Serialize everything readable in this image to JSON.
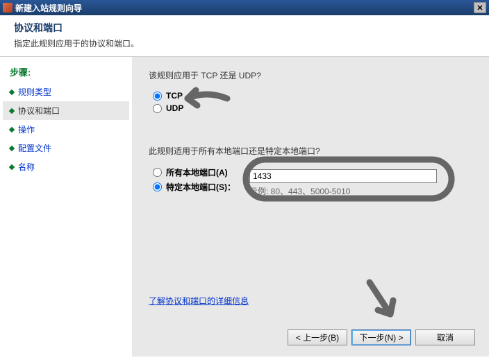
{
  "window": {
    "title": "新建入站规则向导"
  },
  "header": {
    "title": "协议和端口",
    "subtitle": "指定此规则应用于的协议和端口。"
  },
  "sidebar": {
    "steps_label": "步骤:",
    "items": [
      {
        "label": "规则类型",
        "active": false
      },
      {
        "label": "协议和端口",
        "active": true
      },
      {
        "label": "操作",
        "active": false
      },
      {
        "label": "配置文件",
        "active": false
      },
      {
        "label": "名称",
        "active": false
      }
    ]
  },
  "main": {
    "q1": "该规则应用于 TCP 还是 UDP?",
    "protocol": {
      "tcp_label": "TCP",
      "udp_label": "UDP",
      "selected": "tcp"
    },
    "q2": "此规则适用于所有本地端口还是特定本地端口?",
    "ports": {
      "all_label": "所有本地端口(A)",
      "specific_label": "特定本地端口(S)：",
      "selected": "specific",
      "value": "1433",
      "example": "示例: 80、443、5000-5010"
    },
    "learn_more": "了解协议和端口的详细信息"
  },
  "buttons": {
    "back": "< 上一步(B)",
    "next": "下一步(N) >",
    "cancel": "取消"
  }
}
